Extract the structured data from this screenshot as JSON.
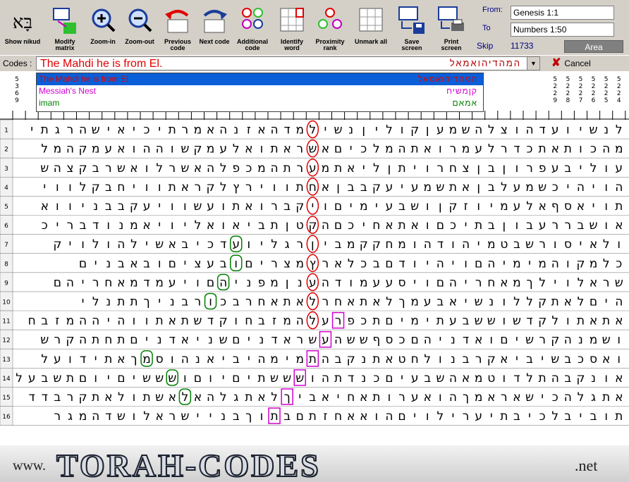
{
  "toolbar": {
    "buttons": [
      {
        "id": "show-nikud",
        "label": "Show nikud",
        "icon": "nikud-icon"
      },
      {
        "id": "modify-matrix",
        "label": "Modify matrix",
        "icon": "matrix-icon"
      },
      {
        "id": "zoom-in",
        "label": "Zoom-in",
        "icon": "zoom-in-icon"
      },
      {
        "id": "zoom-out",
        "label": "Zoom-out",
        "icon": "zoom-out-icon"
      },
      {
        "id": "previous-code",
        "label": "Previous code",
        "icon": "previous-code-icon"
      },
      {
        "id": "next-code",
        "label": "Next code",
        "icon": "next-code-icon"
      },
      {
        "id": "additional-code",
        "label": "Additional code",
        "icon": "additional-code-icon"
      },
      {
        "id": "identify-word",
        "label": "Identify word",
        "icon": "identify-word-icon"
      },
      {
        "id": "proximity-rank",
        "label": "Proximity rank",
        "icon": "proximity-icon"
      },
      {
        "id": "unmark-all",
        "label": "Unmark all",
        "icon": "unmark-icon"
      },
      {
        "id": "save-screen",
        "label": "Save screen",
        "icon": "save-icon"
      },
      {
        "id": "print-screen",
        "label": "Print screen",
        "icon": "print-icon"
      }
    ],
    "nikud_glyph": "בָּא",
    "from_label": "From:",
    "from_value": "Genesis 1:1",
    "to_label": "To",
    "to_value": "Numbers 1:50",
    "skip_label": "Skip",
    "skip_value": "11733",
    "area_label": "Area"
  },
  "codes": {
    "label": "Codes :",
    "current": "The Mahdi he is from El.",
    "current_hebrew": "המהדיהואמאל",
    "cancel_label": "Cancel",
    "dropdown": [
      {
        "text": "The Mahdi he is from El.",
        "hebrew": "המהדיהואמאל",
        "color": "#e00000",
        "selected": true
      },
      {
        "text": "Messiah's Nest",
        "hebrew": "קןמשיח",
        "color": "#d000d0",
        "selected": false
      },
      {
        "text": "imam",
        "hebrew": "אמאם",
        "color": "#008000",
        "selected": false
      }
    ]
  },
  "header": {
    "numbers_left": [
      "5",
      "3",
      "6",
      "9"
    ],
    "numbers_right": [
      [
        "5",
        "2",
        "2",
        "9"
      ],
      [
        "5",
        "2",
        "2",
        "8"
      ],
      [
        "5",
        "2",
        "2",
        "7"
      ],
      [
        "5",
        "2",
        "2",
        "6"
      ],
      [
        "5",
        "2",
        "2",
        "5"
      ],
      [
        "5",
        "2",
        "2",
        "4"
      ]
    ]
  },
  "rows": [
    "לנשיועדהוצלהשמעןקוליןנשילמדהאזנהאמרתיכיאישהרגתי",
    "מהכותאתכדרלעמרואתהמלכיםאשראתואלעמקשוההואעמקהמל",
    "עוליבעפרוןבןצחרויתןליאתמערתהמכפלהאשרלואשרבקצהש",
    "הויהיכשמעלבןאתשמעיעקבבןאחתווירץלקראתוויחבקלווי",
    "תויאסףאלעמיוזקןושבעימיםויקברואתועשוויעקבבניווא",
    "אושבררעבוןבתיכםואתאחיכםהקטןתביאואליויאמנודבריכ",
    "ולאיסורשבטמיהודהומחקקמביןרגליועדכיבאשילהולויק",
    "כלמקוהמימיהםויהיודםבכלארץמצריםובעציםובאבנים",
    "שראלוילךמאחריהםויסעעמודהענןמפניהםויעמדמאחריהם",
    "היםלאתקללונשיאבעמךלאתאחרלאתאחרבכורבניךתתנלי",
    "אתאתולקדשוששבעתימיםתכפרעלהמזבחוקדשתאתווהיההמזבח",
    "ושמנהקרשיםואדניהםכסףששהעשראדניםשניאדניםתחתהקרש",
    "ואסכבשיביאקרבנולחטאתנקבהתמימהיביאנהוסמךאתידועל",
    "אונקבהתלדוטמאהשבעיםכנדתהושששתיםיוםושששיםיוםתשבעלד",
    "אתגלהכישאראמךהואערותאחיאביךלאתגלהאלאשתולאתקרבדד",
    "תוביבלכיבתיערילויםהואאחזתםבתוךבניישראלושדהמגר"
  ],
  "marks": {
    "red": "#e00000",
    "magenta": "#d000d0",
    "green": "#008000"
  },
  "footer": {
    "prefix": "www.",
    "logo": "TORAH-CODES",
    "suffix": ".net"
  }
}
